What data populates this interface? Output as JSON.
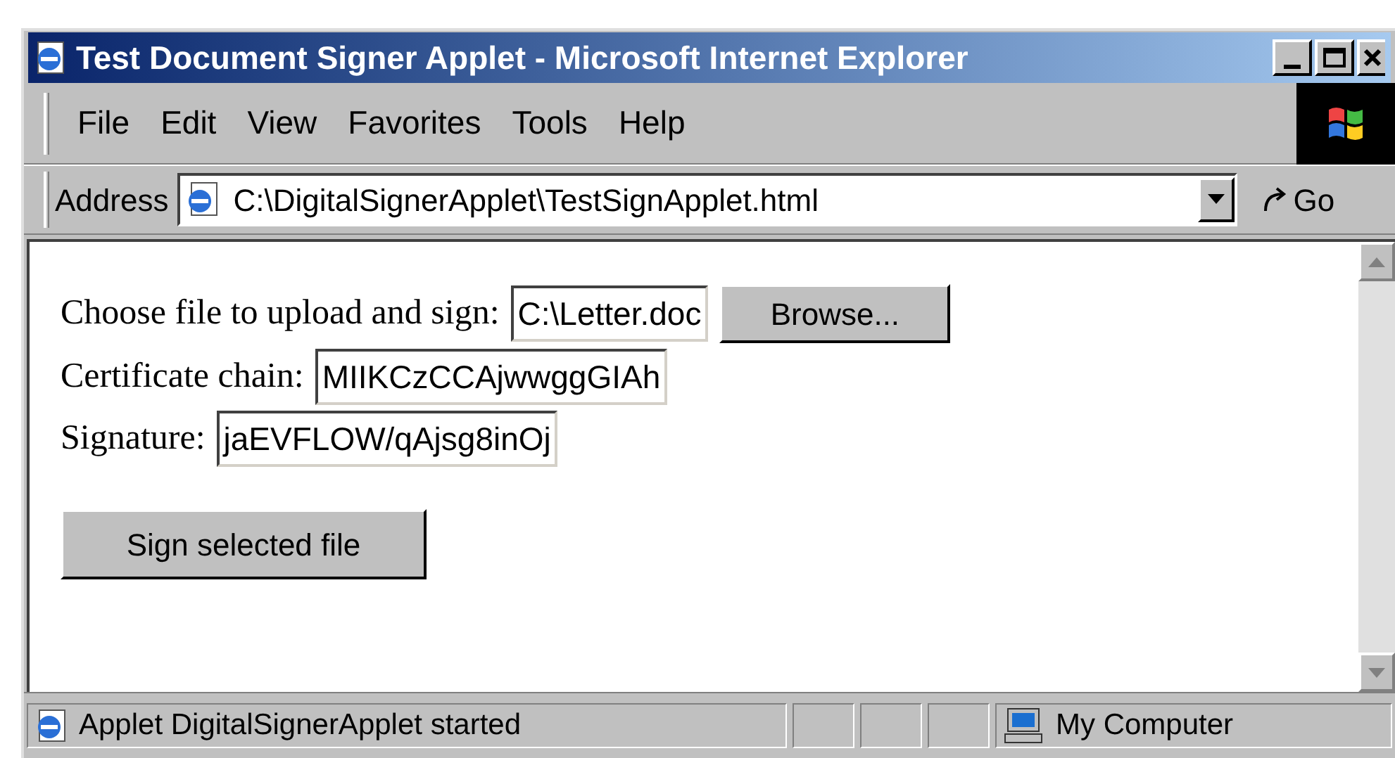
{
  "window": {
    "title": "Test Document Signer Applet - Microsoft Internet Explorer"
  },
  "menu": [
    "File",
    "Edit",
    "View",
    "Favorites",
    "Tools",
    "Help"
  ],
  "address_bar": {
    "label": "Address",
    "value": "C:\\DigitalSignerApplet\\TestSignApplet.html",
    "go": "Go"
  },
  "form": {
    "rows": [
      {
        "label": "Choose file to upload and sign:",
        "value": "C:\\Letter.doc",
        "button": "Browse..."
      },
      {
        "label": "Certificate chain:",
        "value": "MIIKCzCCAjwwggGIAh"
      },
      {
        "label": "Signature:",
        "value": "jaEVFLOW/qAjsg8inOj"
      }
    ],
    "submit": "Sign selected file"
  },
  "status_bar": {
    "message": "Applet DigitalSignerApplet started",
    "zone": "My Computer"
  }
}
